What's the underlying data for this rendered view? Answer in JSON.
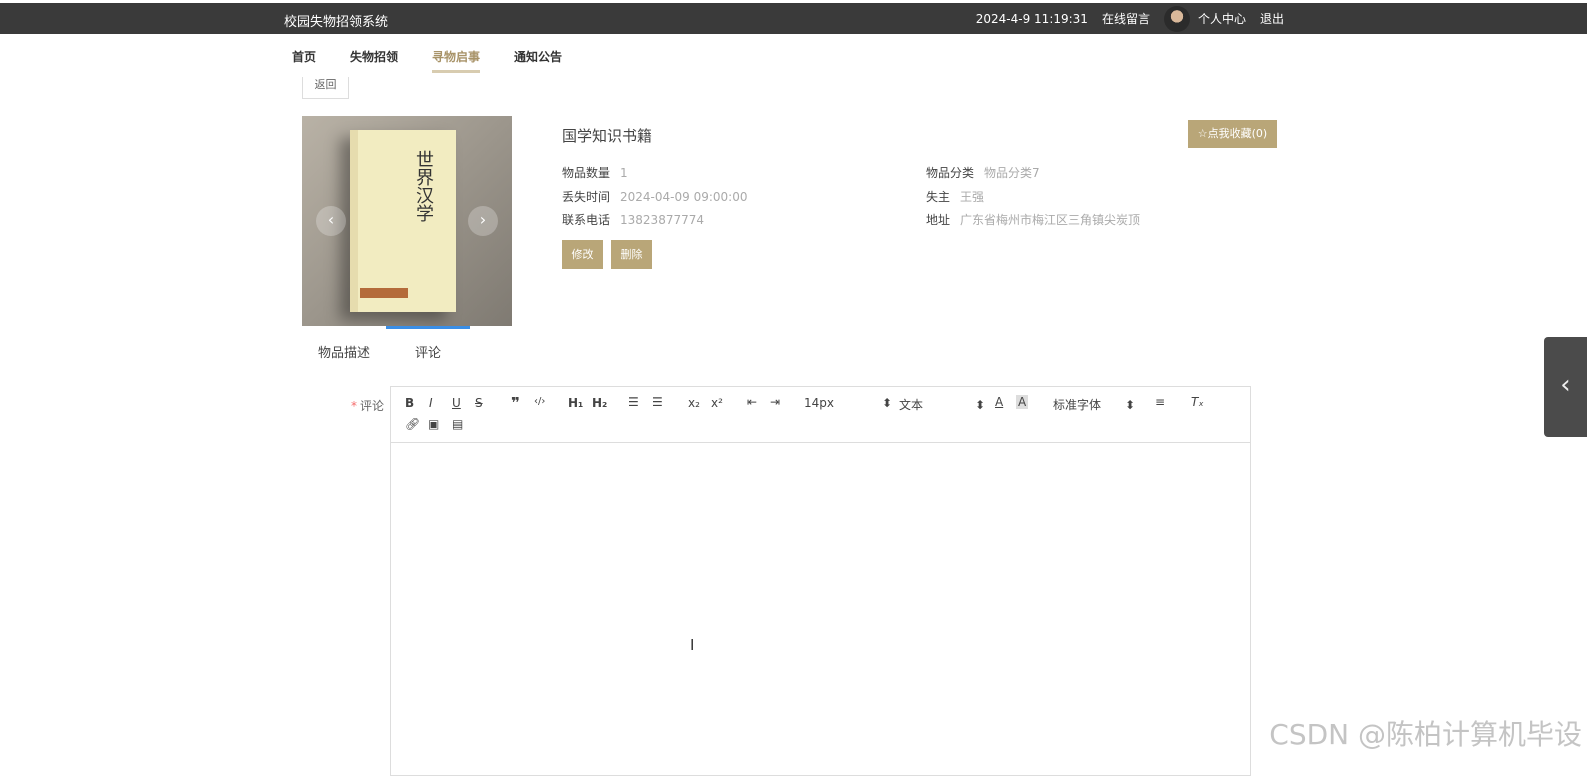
{
  "header": {
    "brand": "校园失物招领系统",
    "datetime": "2024-4-9 11:19:31",
    "links": [
      "在线留言",
      "个人中心",
      "退出"
    ]
  },
  "nav": {
    "items": [
      "首页",
      "失物招领",
      "寻物启事",
      "通知公告"
    ],
    "active": "寻物启事"
  },
  "back_label": "返回",
  "item": {
    "title": "国学知识书籍",
    "favorite_button": "☆点我收藏(0)",
    "fields": [
      {
        "label": "物品数量",
        "value": "1"
      },
      {
        "label": "物品分类",
        "value": "物品分类7"
      },
      {
        "label": "丢失时间",
        "value": "2024-04-09 09:00:00"
      },
      {
        "label": "失主",
        "value": "王强"
      },
      {
        "label": "联系电话",
        "value": "13823877774"
      },
      {
        "label": "地址",
        "value": "广东省梅州市梅江区三角镇尖炭顶"
      }
    ],
    "buttons": [
      "修改",
      "删除"
    ],
    "image_caption": "世界汉学"
  },
  "tabs": [
    "物品描述",
    "评论"
  ],
  "comment": {
    "label": "评论",
    "toolbar": {
      "font_size": "14px",
      "text_style": "文本",
      "font_family": "标准字体"
    }
  },
  "watermark": "CSDN @陈柏计算机毕设"
}
